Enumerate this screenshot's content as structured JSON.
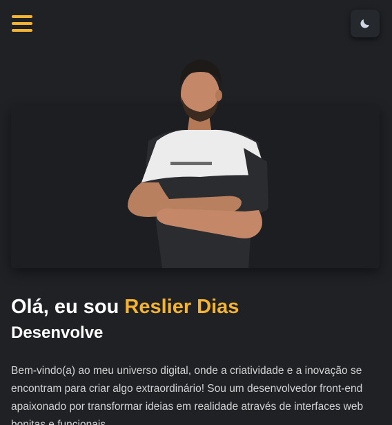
{
  "header": {
    "menu_icon": "hamburger-menu-icon",
    "theme_icon": "moon-icon"
  },
  "colors": {
    "accent": "#f5b332",
    "background": "#1f2125",
    "text": "#ffffff",
    "body_text": "#d4d4d4"
  },
  "hero": {
    "image_alt": "portrait-photo"
  },
  "intro": {
    "greeting_prefix": "Olá, eu sou ",
    "name": "Reslier Dias",
    "role": "Desenvolve",
    "bio": "Bem-vindo(a) ao meu universo digital, onde a criatividade e a inovação se encontram para criar algo extraordinário! Sou um desenvolvedor front-end apaixonado por transformar ideias em realidade através de interfaces web bonitas e funcionais."
  }
}
